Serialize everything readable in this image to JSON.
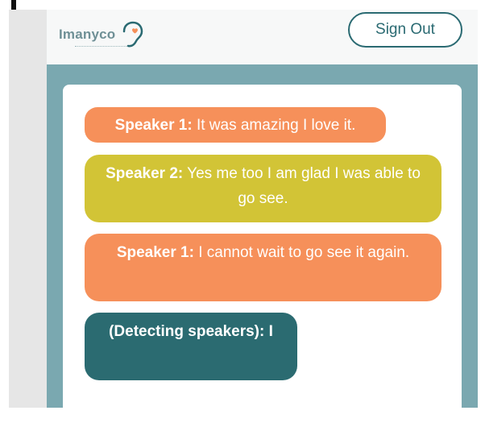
{
  "header": {
    "logo_text": "Imanyco",
    "logo_icon": "ear-heart-icon",
    "sign_out_label": "Sign Out"
  },
  "transcript": [
    {
      "speaker": "Speaker 1:",
      "text": " It was amazing I love it.",
      "color": "#f6905a"
    },
    {
      "speaker": "Speaker 2:",
      "text": " Yes me too I am glad I was able to go see.",
      "color": "#d2c436"
    },
    {
      "speaker": "Speaker 1:",
      "text": " I cannot wait to go see it again.",
      "color": "#f6905a"
    },
    {
      "speaker": "(Detecting speakers):",
      "text": " I",
      "color": "#2b6b71"
    }
  ],
  "colors": {
    "accent": "#2a6a72",
    "frame": "#7aa8b0"
  }
}
